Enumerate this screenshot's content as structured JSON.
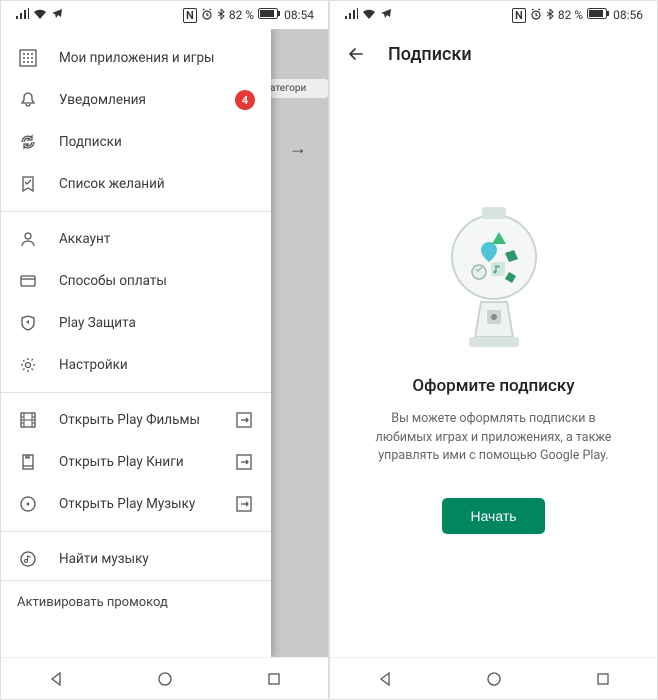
{
  "left": {
    "status": {
      "battery": "82 %",
      "time": "08:54"
    },
    "bg": {
      "categories": "атегори"
    },
    "drawer": {
      "items": [
        {
          "icon": "apps",
          "label": "Мои приложения и игры"
        },
        {
          "icon": "bell",
          "label": "Уведомления",
          "badge": "4"
        },
        {
          "icon": "refresh",
          "label": "Подписки"
        },
        {
          "icon": "bookmark",
          "label": "Список желаний"
        }
      ],
      "items2": [
        {
          "icon": "user",
          "label": "Аккаунт"
        },
        {
          "icon": "card",
          "label": "Способы оплаты"
        },
        {
          "icon": "shield",
          "label": "Play Защита"
        },
        {
          "icon": "gear",
          "label": "Настройки"
        }
      ],
      "items3": [
        {
          "icon": "film",
          "label": "Открыть Play Фильмы",
          "external": true
        },
        {
          "icon": "book",
          "label": "Открыть Play Книги",
          "external": true
        },
        {
          "icon": "music",
          "label": "Открыть Play Музыку",
          "external": true
        }
      ],
      "items4": [
        {
          "icon": "find-music",
          "label": "Найти музыку"
        }
      ],
      "promo": "Активировать промокод"
    }
  },
  "right": {
    "status": {
      "battery": "82 %",
      "time": "08:56"
    },
    "title": "Подписки",
    "sub_title": "Оформите подписку",
    "sub_desc": "Вы можете оформлять подписки в любимых играх и приложениях, а также управлять ими с помощью Google Play.",
    "cta": "Начать"
  }
}
